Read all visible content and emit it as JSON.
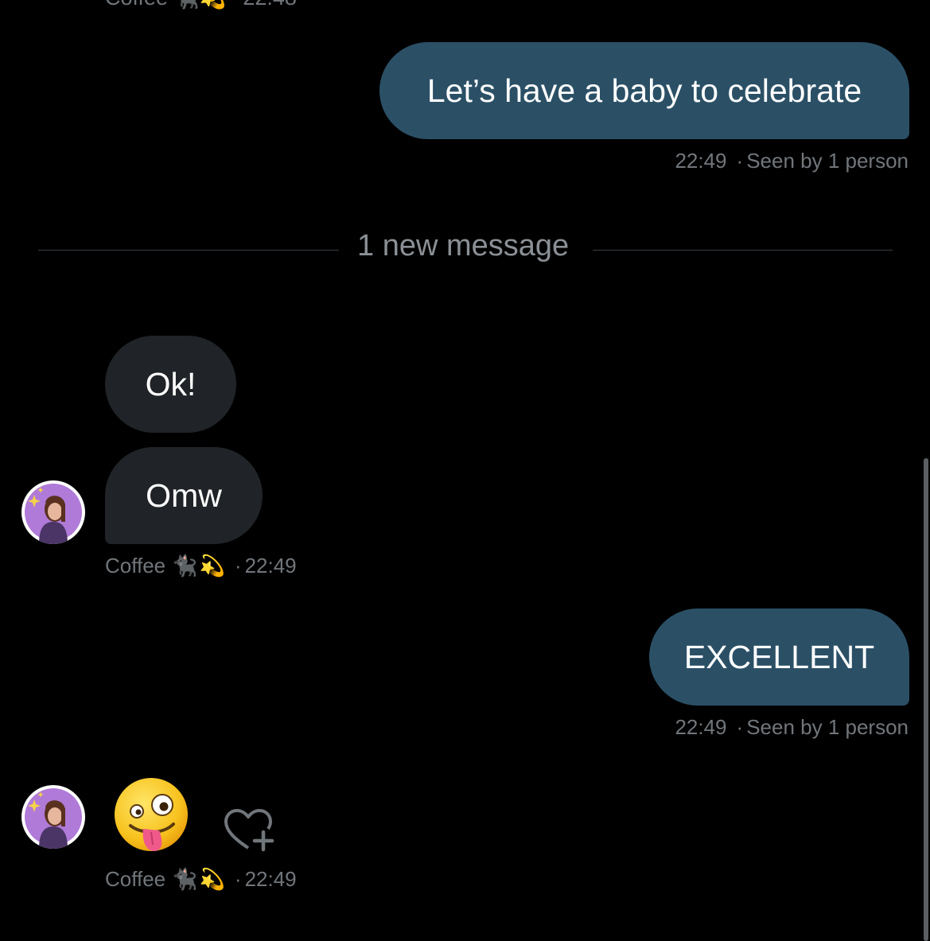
{
  "conversation": {
    "top_partial": {
      "sender": "Coffee",
      "emojis": "🐈‍⬛💫",
      "time": "22:48"
    },
    "messages": [
      {
        "direction": "outgoing",
        "text": "Let’s have a baby to celebrate",
        "time": "22:49",
        "status": "Seen by 1 person"
      },
      {
        "direction": "incoming",
        "text": "Ok!"
      },
      {
        "direction": "incoming",
        "text": "Omw",
        "sender": "Coffee",
        "emojis": "🐈‍⬛💫",
        "time": "22:49"
      },
      {
        "direction": "outgoing",
        "text": "EXCELLENT",
        "time": "22:49",
        "status": "Seen by 1 person"
      },
      {
        "direction": "incoming",
        "emoji": "🤪",
        "sender": "Coffee",
        "emojis": "🐈‍⬛💫",
        "time": "22:49"
      }
    ],
    "divider": {
      "text": "1 new message"
    },
    "dot": "·"
  },
  "icons": {
    "react": "heart-add-icon",
    "avatar": "avatar"
  },
  "colors": {
    "background": "#000000",
    "outgoing_bubble": "#2b5066",
    "incoming_bubble": "#202327",
    "meta_text": "#71767b"
  }
}
